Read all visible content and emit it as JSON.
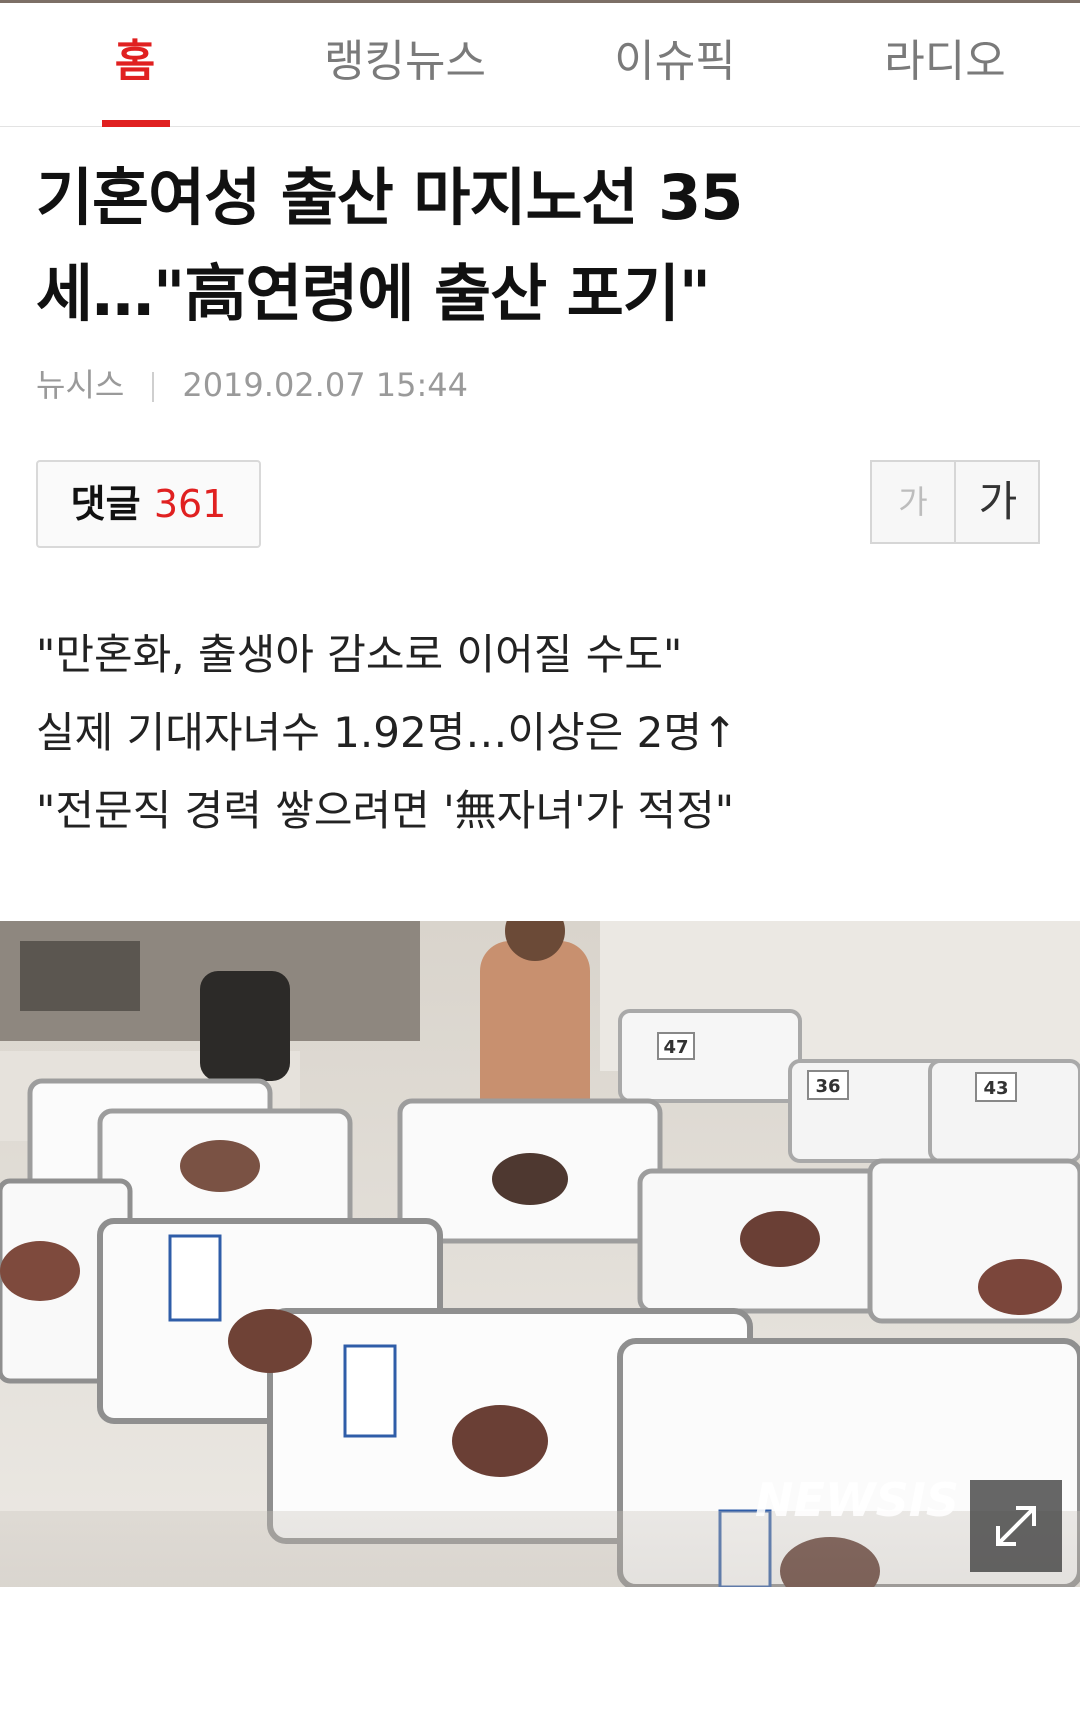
{
  "tabs": [
    {
      "label": "홈",
      "active": true
    },
    {
      "label": "랭킹뉴스",
      "active": false
    },
    {
      "label": "이슈픽",
      "active": false
    },
    {
      "label": "라디오",
      "active": false
    }
  ],
  "article": {
    "title_line1": "기혼여성 출산 마지노선 35",
    "title_line2": "세…\"高연령에 출산 포기\"",
    "source": "뉴시스",
    "datetime": "2019.02.07 15:44",
    "comments_label": "댓글",
    "comments_count": "361",
    "font_small_label": "가",
    "font_large_label": "가",
    "summary": [
      "\"만혼화, 출생아 감소로 이어질 수도\"",
      "실제 기대자녀수 1.92명…이상은 2명↑",
      "\"전문직 경력 쌓으려면 '無자녀'가 적정\""
    ]
  },
  "photo": {
    "watermark": "NEWSIS",
    "bassinet_numbers": [
      "47",
      "36",
      "43"
    ],
    "expand_icon": "expand-icon"
  },
  "colors": {
    "accent": "#e02020",
    "meta_gray": "#9a9a9a"
  }
}
